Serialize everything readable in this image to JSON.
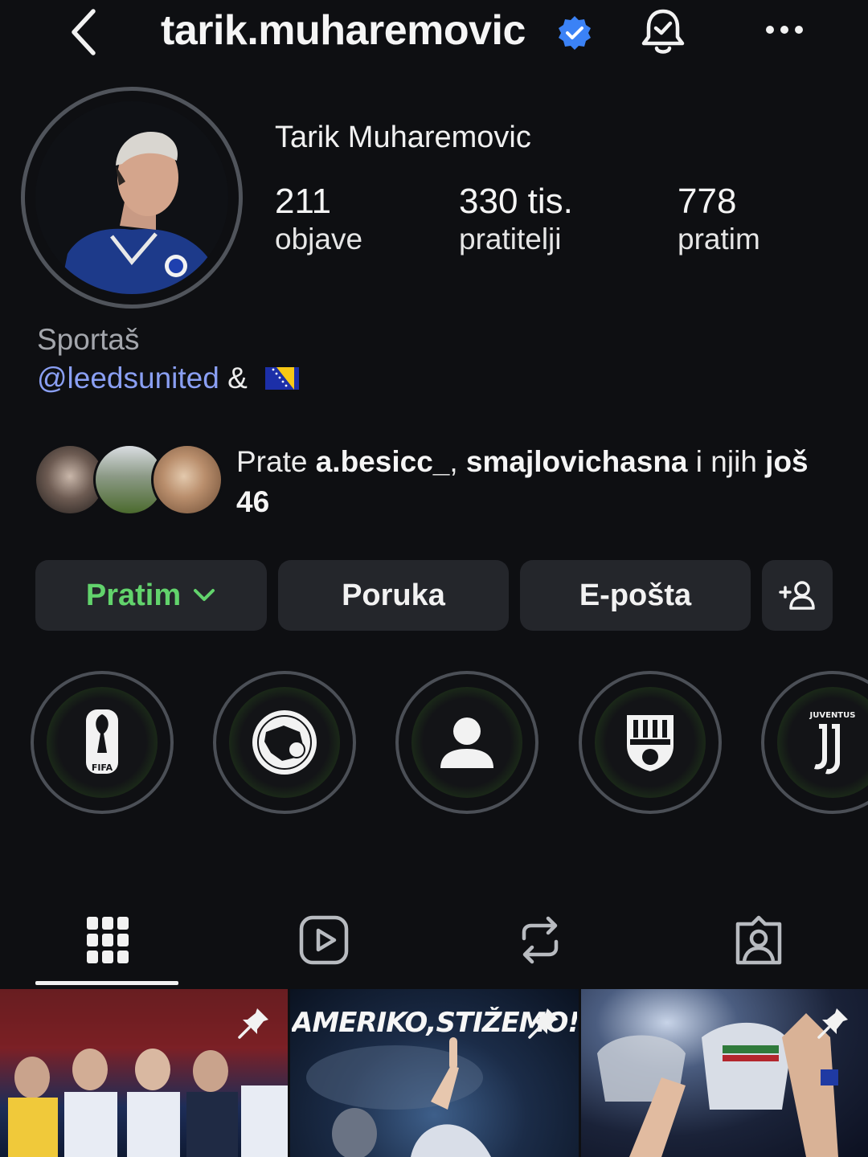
{
  "header": {
    "username": "tarik.muharemovic",
    "verified": true,
    "back_icon": "chevron-left-icon",
    "bell_icon": "bell-check-icon",
    "more_icon": "more-horizontal-icon"
  },
  "profile": {
    "display_name": "Tarik Muharemovic",
    "stats": [
      {
        "value": "211",
        "label": "objave"
      },
      {
        "value": "330 tis.",
        "label": "pratitelji"
      },
      {
        "value": "778",
        "label": "pratim"
      }
    ],
    "category": "Sportaš",
    "bio": {
      "mention": "@leedsunited",
      "amp": "&",
      "flag_icon": "bosnia-flag-icon"
    },
    "mutual": {
      "prefix": "Prate ",
      "user1": "a.besicc_",
      "sep": ", ",
      "user2": "smajlovichasna",
      "middle": " i njih ",
      "count": "još 46"
    }
  },
  "actions": {
    "follow_label": "Pratim",
    "message_label": "Poruka",
    "email_label": "E-pošta",
    "add_icon": "add-person-icon"
  },
  "highlights": [
    {
      "icon": "fifa-world-cup-icon",
      "text": "FIFA"
    },
    {
      "icon": "bosnia-federation-icon"
    },
    {
      "icon": "person-silhouette-icon"
    },
    {
      "icon": "sassuolo-crest-icon"
    },
    {
      "icon": "juventus-logo-icon",
      "text": "JUVENTUS"
    }
  ],
  "tabs": [
    {
      "icon": "grid-icon",
      "active": true
    },
    {
      "icon": "reels-icon"
    },
    {
      "icon": "reposts-icon"
    },
    {
      "icon": "tagged-icon"
    }
  ],
  "posts": [
    {
      "pinned": true
    },
    {
      "pinned": true,
      "caption": "AMERIKO,STIŽEMO!"
    },
    {
      "pinned": true
    }
  ],
  "colors": {
    "background": "#0e0f12",
    "button_bg": "#24262b",
    "follow_green": "#62d36c",
    "mention_blue": "#8a9ff3",
    "verified_blue": "#3b82f6"
  }
}
